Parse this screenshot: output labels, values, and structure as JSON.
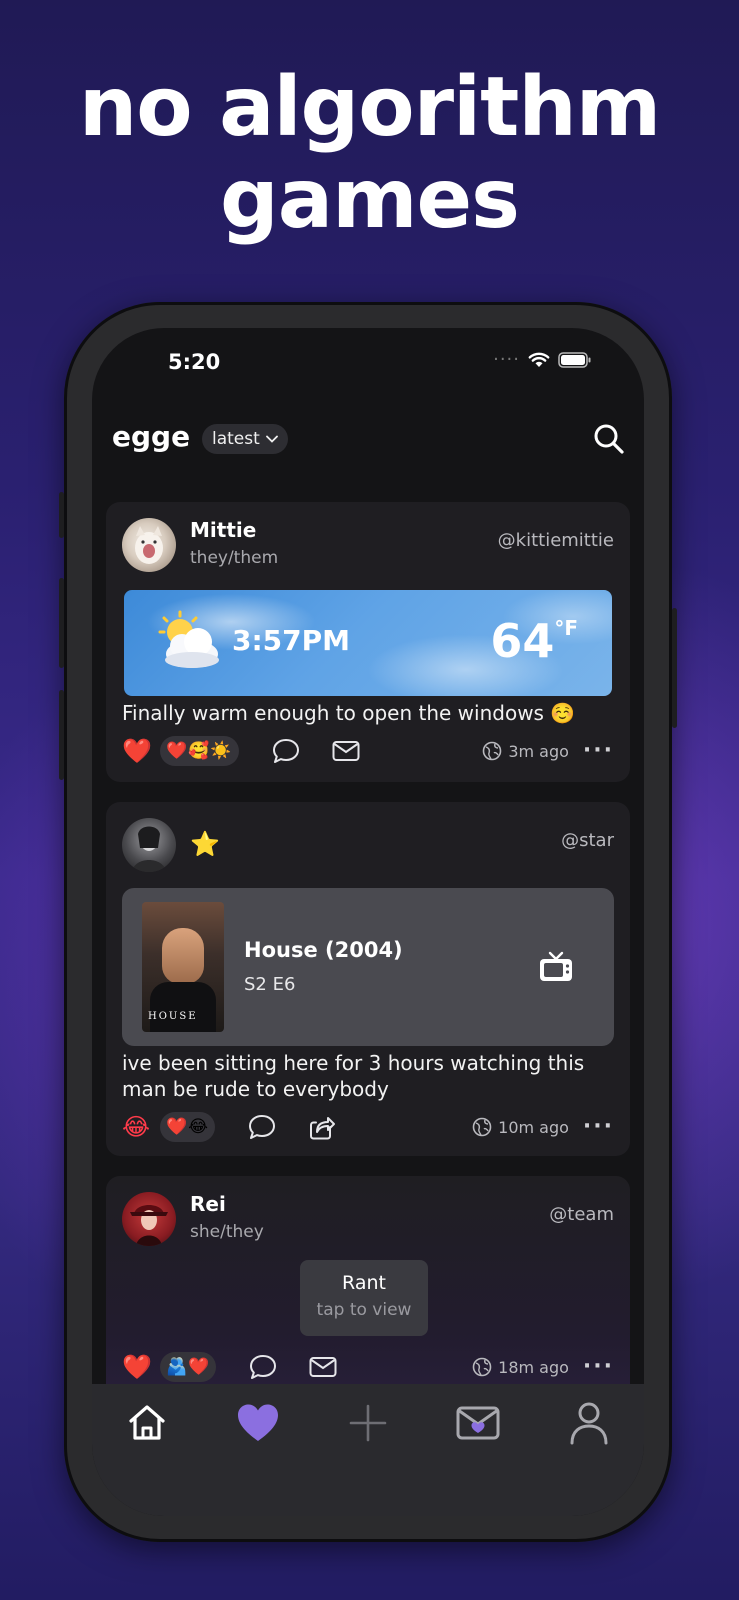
{
  "headline": {
    "line1": "no algorithm",
    "line2": "games"
  },
  "status_bar": {
    "time": "5:20"
  },
  "header": {
    "app_name": "egge",
    "feed_selector": "latest"
  },
  "posts": [
    {
      "name": "Mittie",
      "pronouns": "they/them",
      "handle": "@kittiemittie",
      "widget": {
        "type": "weather",
        "time": "3:57PM",
        "temperature": "64",
        "unit": "°F",
        "icon": "sun-behind-cloud-icon"
      },
      "text": "Finally warm enough to open the windows ☺️",
      "my_reaction": "❤️",
      "reactions": "❤️🥰☀️",
      "actions": [
        "comment-icon",
        "mail-icon"
      ],
      "time_ago": "3m ago"
    },
    {
      "name": "⭐",
      "pronouns": "",
      "handle": "@star",
      "media": {
        "title": "House (2004)",
        "episode": "S2 E6",
        "poster_text": "HOUSE",
        "icon": "tv-icon"
      },
      "text_line1": "ive been sitting here for 3 hours watching this",
      "text_line2": "man be rude to everybody",
      "my_reaction": "😂",
      "reactions": "❤️😂",
      "actions": [
        "comment-icon",
        "share-icon"
      ],
      "time_ago": "10m ago"
    },
    {
      "name": "Rei",
      "pronouns": "she/they",
      "handle": "@team",
      "hidden_post": {
        "label": "Rant",
        "hint": "tap to view"
      },
      "my_reaction": "❤️",
      "reactions": "🫂❤️",
      "actions": [
        "comment-icon",
        "mail-icon"
      ],
      "time_ago": "18m ago"
    }
  ],
  "tabbar": {
    "tabs": [
      "home-icon",
      "heart-icon",
      "plus-icon",
      "inbox-icon",
      "profile-icon"
    ],
    "accent": "#8b6fe0"
  }
}
